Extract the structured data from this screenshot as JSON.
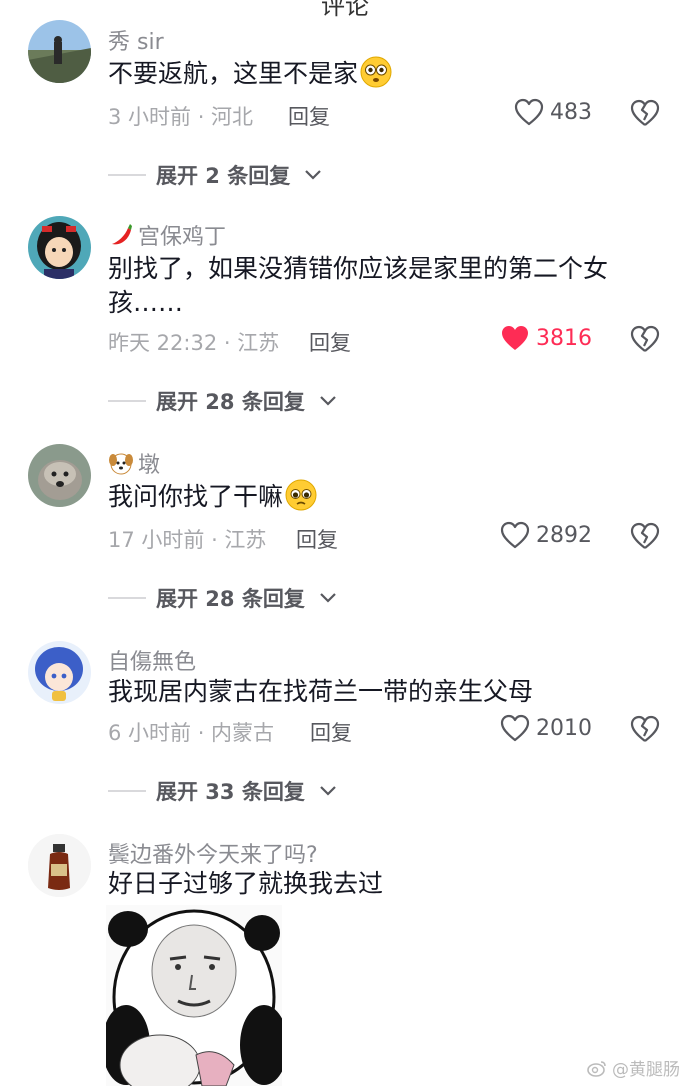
{
  "header": {
    "partial_title": "评论"
  },
  "comments": [
    {
      "username": "秀 sir",
      "text": "不要返航，这里不是家",
      "time_location": "3 小时前 · 河北",
      "reply_label": "回复",
      "likes": "483",
      "liked": false,
      "expand_label": "展开 2 条回复"
    },
    {
      "username": "宫保鸡丁",
      "text": "别找了，如果没猜错你应该是家里的第二个女孩……",
      "time_location": "昨天 22:32 · 江苏",
      "reply_label": "回复",
      "likes": "3816",
      "liked": true,
      "expand_label": "展开 28 条回复"
    },
    {
      "username": "墩",
      "text": "我问你找了干嘛",
      "time_location": "17 小时前 · 江苏",
      "reply_label": "回复",
      "likes": "2892",
      "liked": false,
      "expand_label": "展开 28 条回复"
    },
    {
      "username": "自傷無色",
      "text": "我现居内蒙古在找荷兰一带的亲生父母",
      "time_location": "6 小时前 · 内蒙古",
      "reply_label": "回复",
      "likes": "2010",
      "liked": false,
      "expand_label": "展开 33 条回复"
    },
    {
      "username": "鬓边番外今天来了吗?",
      "text": "好日子过够了就换我去过"
    }
  ],
  "watermark": "@黄腿肠",
  "colors": {
    "like_active": "#fe2c55",
    "meta_gray": "#a6a7ab",
    "username_gray": "#8a8b91"
  }
}
